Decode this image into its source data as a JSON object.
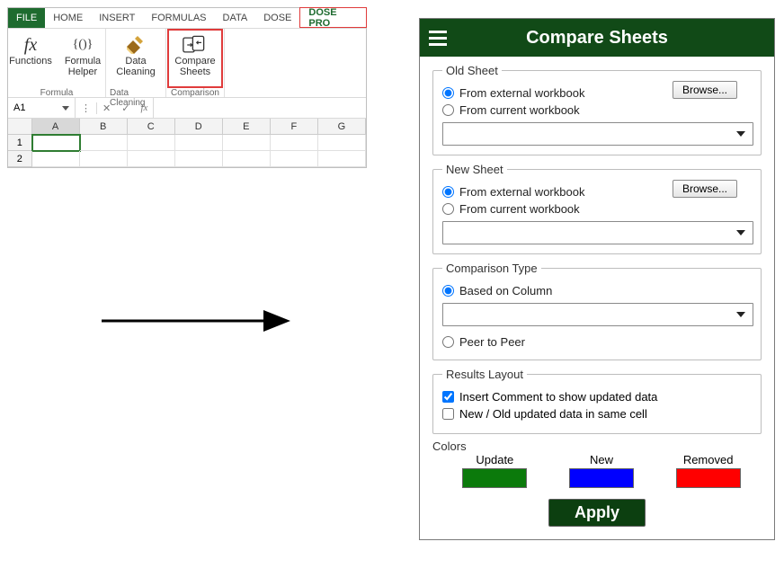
{
  "tabs": {
    "file": "FILE",
    "home": "HOME",
    "insert": "INSERT",
    "formulas": "FORMULAS",
    "data": "DATA",
    "dose": "DOSE",
    "dosepro": "DOSE PRO"
  },
  "ribbon": {
    "formula_group": "Formula",
    "functions": "Functions",
    "functions_glyph": "fx",
    "formula_helper_l1": "Formula",
    "formula_helper_l2": "Helper",
    "formula_helper_glyph": "{()}",
    "data_cleaning_group": "Data Cleaning",
    "data_cleaning_l1": "Data",
    "data_cleaning_l2": "Cleaning",
    "comparison_group": "Comparison",
    "compare_l1": "Compare",
    "compare_l2": "Sheets"
  },
  "formula_bar": {
    "name_box": "A1",
    "fx": "fx"
  },
  "grid": {
    "columns": [
      "A",
      "B",
      "C",
      "D",
      "E",
      "F",
      "G"
    ],
    "rows": [
      "1",
      "2"
    ]
  },
  "pane": {
    "title": "Compare Sheets",
    "old_sheet": {
      "legend": "Old Sheet",
      "opt1": "From external workbook",
      "opt2": "From current workbook",
      "browse": "Browse..."
    },
    "new_sheet": {
      "legend": "New Sheet",
      "opt1": "From external workbook",
      "opt2": "From current workbook",
      "browse": "Browse..."
    },
    "comparison": {
      "legend": "Comparison Type",
      "opt1": "Based on Column",
      "opt2": "Peer to Peer"
    },
    "results": {
      "legend": "Results Layout",
      "chk1": "Insert Comment to show updated data",
      "chk2": "New / Old updated data in same cell"
    },
    "colors": {
      "title": "Colors",
      "update": "Update",
      "new": "New",
      "removed": "Removed",
      "update_hex": "#0b7a0b",
      "new_hex": "#0000ff",
      "removed_hex": "#ff0000"
    },
    "apply": "Apply"
  }
}
